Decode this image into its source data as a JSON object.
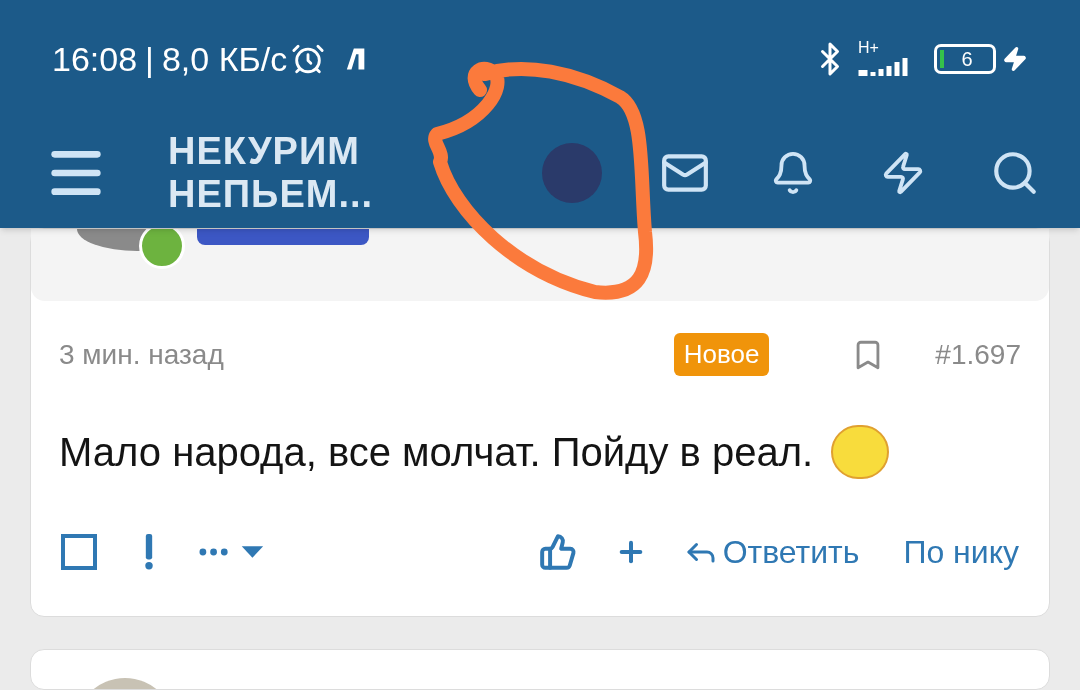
{
  "status_bar": {
    "time": "16:08",
    "separator": "|",
    "speed": "8,0 КБ/с",
    "network": "H+",
    "battery": "6"
  },
  "header": {
    "title": "НЕКУРИМ НЕПЬЕМ..."
  },
  "post": {
    "time": "3 мин. назад",
    "badge": "Новое",
    "number": "#1.697",
    "text": "Мало народа, все молчат. Пойду в реал.",
    "selected": false,
    "actions": [
      {
        "kind": "reply",
        "label": "Ответить"
      },
      {
        "kind": "link",
        "label": "По нику"
      }
    ]
  }
}
